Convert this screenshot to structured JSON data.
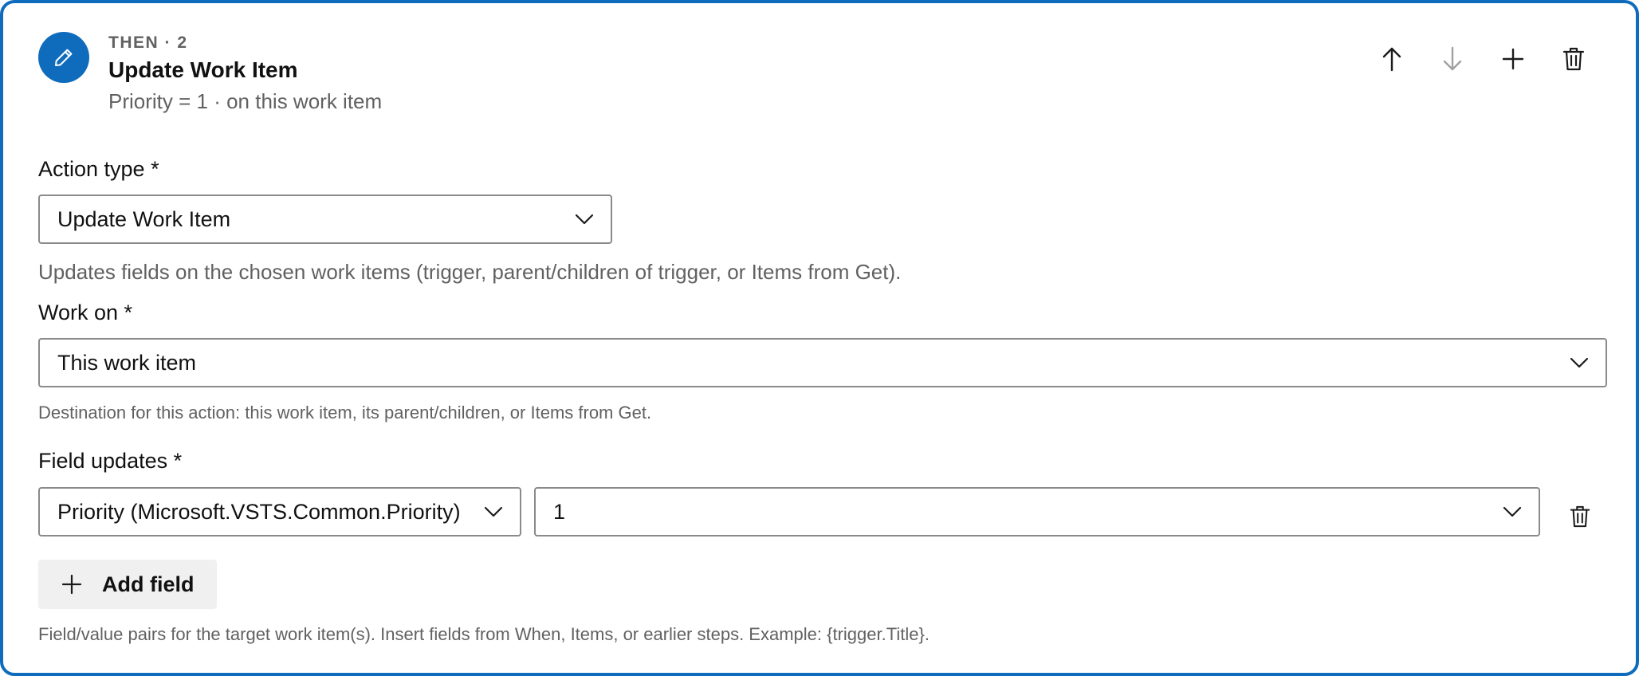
{
  "header": {
    "eyebrow": "THEN · 2",
    "title": "Update Work Item",
    "subtitle": "Priority = 1 · on this work item",
    "icon": "pencil-icon"
  },
  "toolbar": {
    "move_up_icon": "arrow-up-icon",
    "move_down_icon": "arrow-down-icon",
    "add_icon": "plus-icon",
    "delete_icon": "trash-icon"
  },
  "action_type": {
    "label": "Action type *",
    "value": "Update Work Item",
    "help": "Updates fields on the chosen work items (trigger, parent/children of trigger, or Items from Get)."
  },
  "work_on": {
    "label": "Work on *",
    "value": "This work item",
    "help": "Destination for this action: this work item, its parent/children, or Items from Get."
  },
  "field_updates": {
    "label": "Field updates *",
    "rows": [
      {
        "field": "Priority (Microsoft.VSTS.Common.Priority)",
        "value": "1"
      }
    ],
    "add_label": "Add field",
    "help": "Field/value pairs for the target work item(s). Insert fields from When, Items, or earlier steps. Example: {trigger.Title}."
  },
  "colors": {
    "accent": "#0f6cbd",
    "muted_text": "#616161",
    "border": "#8a8a8a",
    "disabled_icon": "#a0a0a0"
  }
}
